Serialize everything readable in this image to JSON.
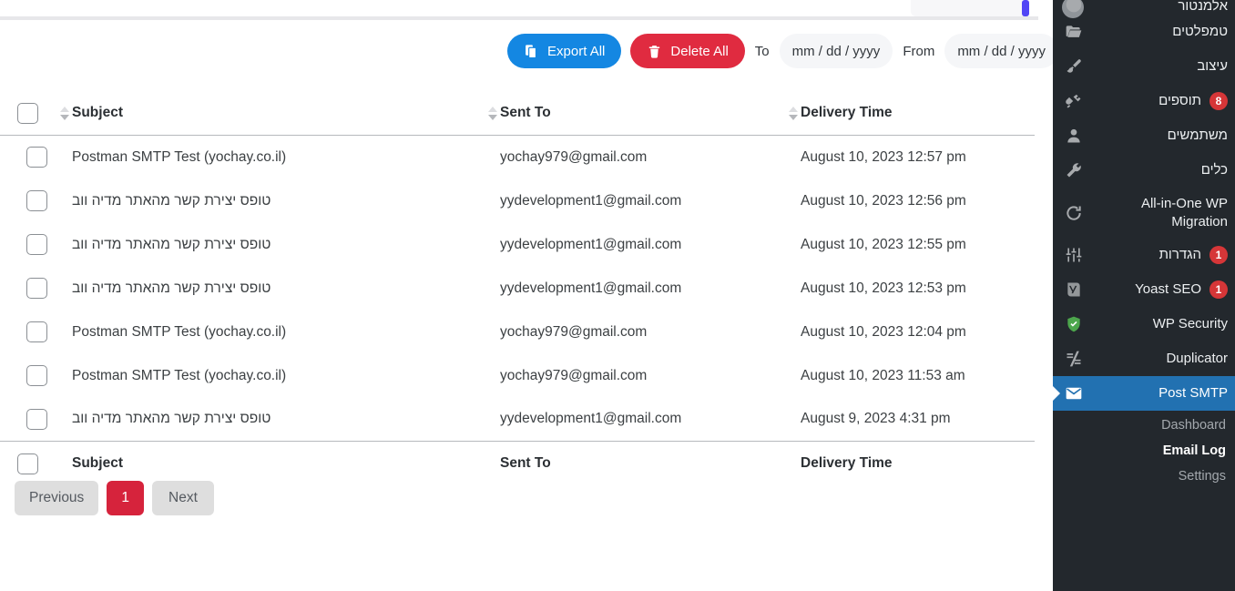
{
  "colors": {
    "delete_button": "#e02b40",
    "export_button": "#1487e2",
    "pagination_active": "#d6233c",
    "sidebar_bg": "#23282d",
    "sidebar_active": "#2271b1",
    "badge": "#d63638",
    "scrollbar_thumb": "#5145f5"
  },
  "toolbar": {
    "date_from": {
      "placeholder": "mm / dd / yyyy",
      "value": "mm / dd / yyyy",
      "label": "From"
    },
    "date_to": {
      "placeholder": "mm / dd / yyyy",
      "value": "mm / dd / yyyy",
      "label": "To"
    },
    "delete_all_label": "Delete All",
    "export_all_label": "Export All",
    "delete_icon": "trash-icon",
    "export_icon": "copy-icon"
  },
  "table": {
    "columns": {
      "delivery_time": "Delivery Time",
      "sent_to": "Sent To",
      "subject": "Subject"
    },
    "rows": [
      {
        "delivery_time": "August 10, 2023 12:57 pm",
        "sent_to": "yochay979@gmail.com",
        "subject": "Postman SMTP Test (yochay.co.il)",
        "subject_rtl": false
      },
      {
        "delivery_time": "August 10, 2023 12:56 pm",
        "sent_to": "yydevelopment1@gmail.com",
        "subject": "טופס יצירת קשר מהאתר מדיה ווב",
        "subject_rtl": true
      },
      {
        "delivery_time": "August 10, 2023 12:55 pm",
        "sent_to": "yydevelopment1@gmail.com",
        "subject": "טופס יצירת קשר מהאתר מדיה ווב",
        "subject_rtl": true
      },
      {
        "delivery_time": "August 10, 2023 12:53 pm",
        "sent_to": "yydevelopment1@gmail.com",
        "subject": "טופס יצירת קשר מהאתר מדיה ווב",
        "subject_rtl": true
      },
      {
        "delivery_time": "August 10, 2023 12:04 pm",
        "sent_to": "yochay979@gmail.com",
        "subject": "Postman SMTP Test (yochay.co.il)",
        "subject_rtl": false
      },
      {
        "delivery_time": "August 10, 2023 11:53 am",
        "sent_to": "yochay979@gmail.com",
        "subject": "Postman SMTP Test (yochay.co.il)",
        "subject_rtl": false
      },
      {
        "delivery_time": "August 9, 2023 4:31 pm",
        "sent_to": "yydevelopment1@gmail.com",
        "subject": "טופס יצירת קשר מהאתר מדיה ווב",
        "subject_rtl": true
      }
    ]
  },
  "pagination": {
    "next_label": "Next",
    "previous_label": "Previous",
    "current_page": "1"
  },
  "sidebar": {
    "items": [
      {
        "label": "אלמנטור",
        "icon": "elementor-icon",
        "badge": null,
        "cut": true,
        "active": false
      },
      {
        "label": "טמפלטים",
        "icon": "folder-icon",
        "badge": null,
        "cut": false,
        "active": false
      },
      {
        "label": "עיצוב",
        "icon": "brush-icon",
        "badge": null,
        "cut": false,
        "active": false
      },
      {
        "label": "תוספים",
        "icon": "plug-icon",
        "badge": "8",
        "cut": false,
        "active": false
      },
      {
        "label": "משתמשים",
        "icon": "user-icon",
        "badge": null,
        "cut": false,
        "active": false
      },
      {
        "label": "כלים",
        "icon": "wrench-icon",
        "badge": null,
        "cut": false,
        "active": false
      },
      {
        "label": "All-in-One WP Migration",
        "icon": "migration-icon",
        "badge": null,
        "cut": false,
        "active": false
      },
      {
        "label": "הגדרות",
        "icon": "settings-icon",
        "badge": "1",
        "cut": false,
        "active": false
      },
      {
        "label": "Yoast SEO",
        "icon": "yoast-icon",
        "badge": "1",
        "cut": false,
        "active": false
      },
      {
        "label": "WP Security",
        "icon": "shield-icon",
        "badge": null,
        "cut": false,
        "active": false
      },
      {
        "label": "Duplicator",
        "icon": "duplicator-icon",
        "badge": null,
        "cut": false,
        "active": false
      },
      {
        "label": "Post SMTP",
        "icon": "envelope-icon",
        "badge": null,
        "cut": false,
        "active": true
      }
    ],
    "submenu": [
      {
        "label": "Dashboard",
        "current": false
      },
      {
        "label": "Email Log",
        "current": true
      },
      {
        "label": "Settings",
        "current": false
      }
    ]
  }
}
